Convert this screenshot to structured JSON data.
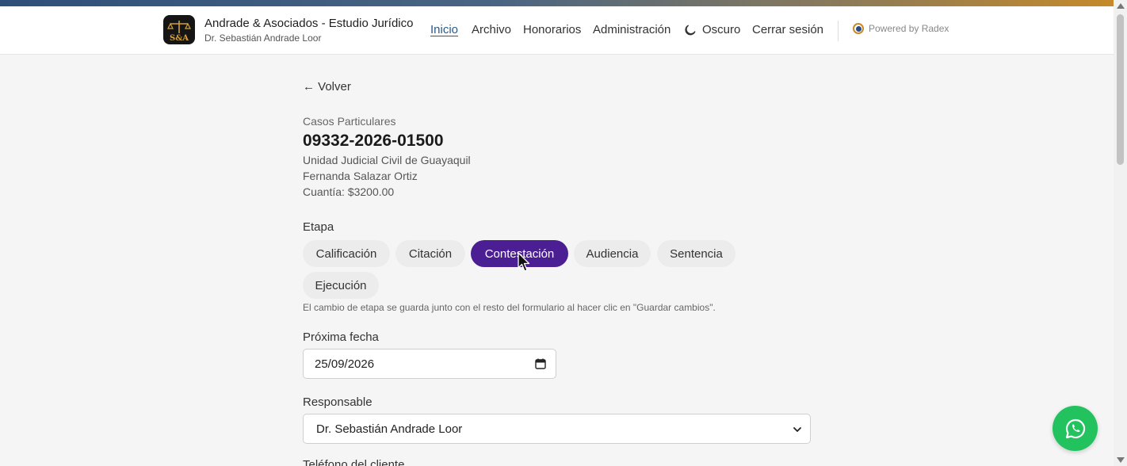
{
  "header": {
    "logo_text": "S&A",
    "brand_title": "Andrade & Asociados - Estudio Jurídico",
    "brand_subtitle": "Dr. Sebastián Andrade Loor",
    "nav": {
      "inicio": "Inicio",
      "archivo": "Archivo",
      "honorarios": "Honorarios",
      "administracion": "Administración",
      "oscuro": "Oscuro",
      "logout": "Cerrar sesión"
    },
    "powered_by": "Powered by Radex"
  },
  "back": {
    "label": "← Volver"
  },
  "case": {
    "category": "Casos Particulares",
    "number": "09332-2026-01500",
    "court": "Unidad Judicial Civil de Guayaquil",
    "client": "Fernanda Salazar Ortiz",
    "amount": "Cuantía: $3200.00"
  },
  "stage": {
    "label": "Etapa",
    "options": [
      "Calificación",
      "Citación",
      "Contestación",
      "Audiencia",
      "Sentencia",
      "Ejecución"
    ],
    "selected": "Contestación",
    "hint": "El cambio de etapa se guarda junto con el resto del formulario al hacer clic en \"Guardar cambios\"."
  },
  "next_date": {
    "label": "Próxima fecha",
    "value": "25/09/2026"
  },
  "responsible": {
    "label": "Responsable",
    "value": "Dr. Sebastián Andrade Loor"
  },
  "client_phone": {
    "label": "Teléfono del cliente"
  },
  "colors": {
    "accent": "#4b1e94",
    "link": "#2a5a8a",
    "whatsapp": "#22c35e"
  },
  "icons": {
    "theme": "moon-icon",
    "calendar": "calendar-icon",
    "select": "chevron-down-icon",
    "chat": "whatsapp-icon"
  }
}
